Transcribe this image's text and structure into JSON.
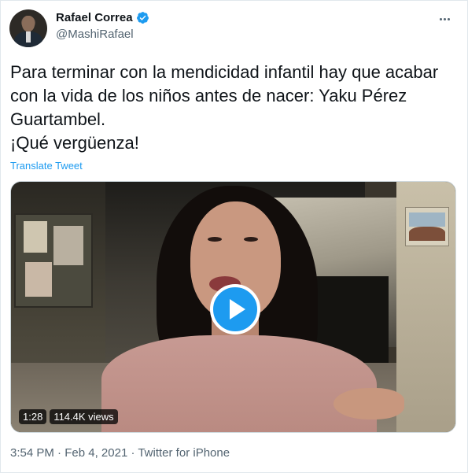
{
  "author": {
    "display_name": "Rafael Correa",
    "handle": "@MashiRafael",
    "verified": true
  },
  "tweet": {
    "lines": [
      "Para terminar con la mendicidad infantil hay que acabar",
      "con la vida de los niños antes de nacer: Yaku Pérez",
      "Guartambel.",
      "¡Qué vergüenza!"
    ],
    "translate_label": "Translate Tweet"
  },
  "media": {
    "type": "video",
    "duration": "1:28",
    "views": "114.4K views"
  },
  "meta": {
    "time": "3:54 PM",
    "separator1": " · ",
    "date": "Feb 4, 2021",
    "separator2": " · ",
    "source": "Twitter for iPhone"
  },
  "colors": {
    "accent": "#1d9bf0",
    "text": "#0f1419",
    "secondary": "#536471"
  },
  "icons": {
    "verified": "verified-badge-icon",
    "more": "more-options-icon",
    "play": "play-icon"
  }
}
